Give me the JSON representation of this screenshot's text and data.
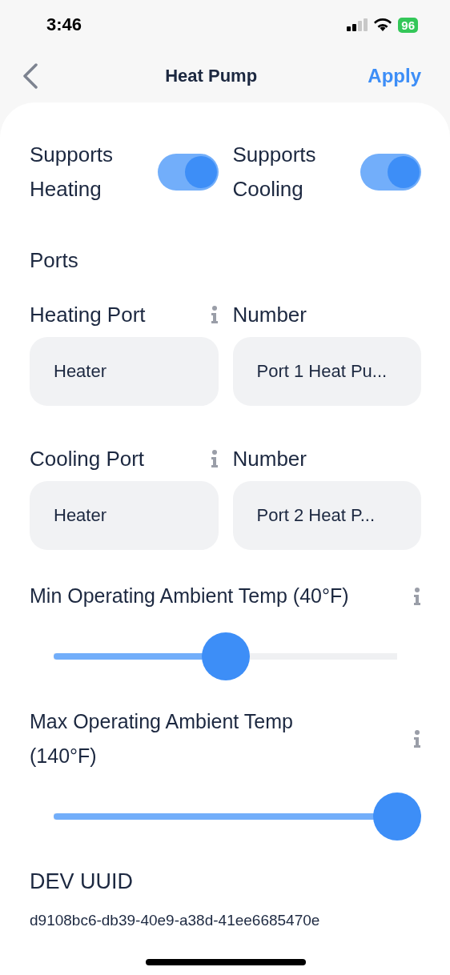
{
  "status_bar": {
    "time": "3:46",
    "battery": "96"
  },
  "nav": {
    "title": "Heat Pump",
    "action": "Apply"
  },
  "toggles": [
    {
      "label": "Supports Heating",
      "on": true
    },
    {
      "label": "Supports Cooling",
      "on": true
    }
  ],
  "ports": {
    "title": "Ports",
    "rows": [
      {
        "label": "Heating Port",
        "number_label": "Number",
        "value": "Heater",
        "number_value": "Port 1 Heat Pu..."
      },
      {
        "label": "Cooling Port",
        "number_label": "Number",
        "value": "Heater",
        "number_value": "Port 2 Heat P..."
      }
    ]
  },
  "sliders": [
    {
      "label": "Min Operating Ambient Temp (40°F)",
      "level": 0.5
    },
    {
      "label": "Max Operating Ambient Temp (140°F)",
      "level": 1
    }
  ],
  "dev_uuid": {
    "title": "DEV UUID",
    "value": "d9108bc6-db39-40e9-a38d-41ee6685470e"
  }
}
